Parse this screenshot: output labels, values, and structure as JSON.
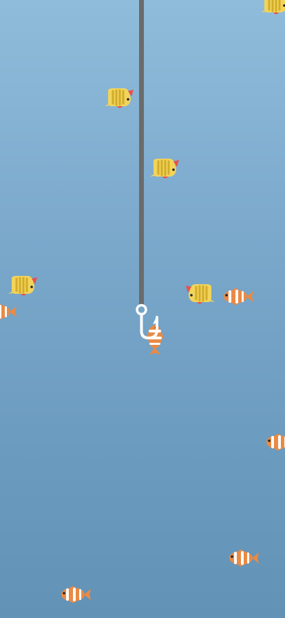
{
  "colors": {
    "water_top": "#90bcdb",
    "water_bottom": "#6292b6",
    "line": "#6b6b6b",
    "hook": "#ffffff",
    "butterflyfish_body": "#f2d45a",
    "butterflyfish_stripe": "#d2ac2a",
    "butterflyfish_fin": "#e8514a",
    "clownfish_body": "#e98a45",
    "clownfish_stripe": "#ffffff"
  },
  "icons": {
    "line": "fishing-line-icon",
    "hook": "fishing-hook-icon",
    "butterflyfish": "butterflyfish-icon",
    "clownfish": "clownfish-icon"
  },
  "fish": [
    {
      "species": "butterflyfish",
      "facing": "right"
    },
    {
      "species": "butterflyfish",
      "facing": "right"
    },
    {
      "species": "butterflyfish",
      "facing": "right"
    },
    {
      "species": "butterflyfish",
      "facing": "right"
    },
    {
      "species": "butterflyfish",
      "facing": "left"
    },
    {
      "species": "clownfish",
      "facing": "left"
    },
    {
      "species": "clownfish",
      "facing": "left"
    },
    {
      "species": "clownfish",
      "facing": "hooked"
    },
    {
      "species": "clownfish",
      "facing": "left"
    },
    {
      "species": "clownfish",
      "facing": "left"
    },
    {
      "species": "clownfish",
      "facing": "left"
    }
  ]
}
